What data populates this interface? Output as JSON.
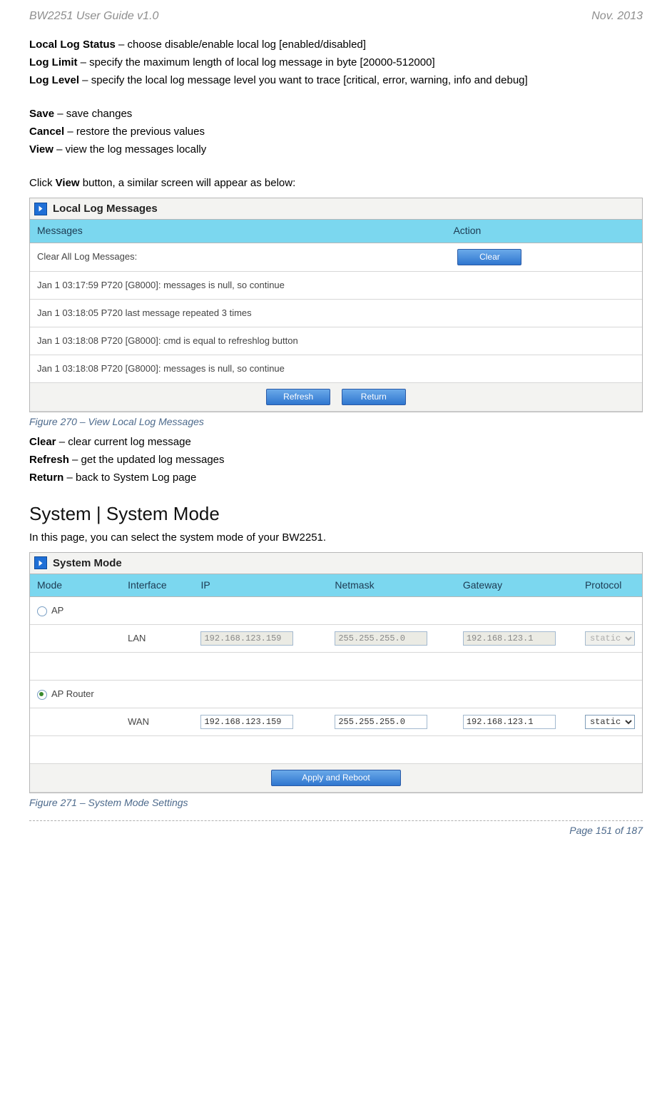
{
  "header": {
    "left": "BW2251 User Guide v1.0",
    "right": "Nov.  2013"
  },
  "defs": {
    "localLogStatus": {
      "term": "Local Log Status",
      "desc": " – choose disable/enable local log [enabled/disabled]"
    },
    "logLimit": {
      "term": "Log Limit",
      "desc": " – specify the maximum length of local log message in byte [20000-512000]"
    },
    "logLevel": {
      "term": "Log Level",
      "desc": " – specify the local log message level you want to trace [critical, error, warning, info and debug]"
    },
    "save": {
      "term": "Save",
      "desc": " – save changes"
    },
    "cancel": {
      "term": "Cancel",
      "desc": " – restore the previous values"
    },
    "view": {
      "term": "View",
      "desc": " – view the log messages locally"
    },
    "clickView_pre": "Click ",
    "clickView_bold": "View",
    "clickView_post": " button, a similar screen will appear as below:",
    "clear": {
      "term": "Clear",
      "desc": " – clear current log message"
    },
    "refresh": {
      "term": "Refresh",
      "desc": " – get the updated log messages"
    },
    "return": {
      "term": "Return",
      "desc": " – back to System Log page"
    }
  },
  "logBox": {
    "title": "Local Log Messages",
    "cols": {
      "messages": "Messages",
      "action": "Action"
    },
    "clearRowLabel": "Clear All Log Messages:",
    "clearBtn": "Clear",
    "rows": [
      "Jan 1 03:17:59 P720 [G8000]: messages is null, so continue",
      "Jan 1 03:18:05 P720 last message repeated 3 times",
      "Jan 1 03:18:08 P720 [G8000]: cmd is equal to refreshlog button",
      "Jan 1 03:18:08 P720 [G8000]: messages is null, so continue"
    ],
    "refreshBtn": "Refresh",
    "returnBtn": "Return"
  },
  "fig270": "Figure 270 – View Local Log Messages",
  "sectionTitle": "System | System Mode",
  "sectionIntro": "In this page, you can select the system mode of your BW2251.",
  "modeBox": {
    "title": "System Mode",
    "cols": {
      "mode": "Mode",
      "iface": "Interface",
      "ip": "IP",
      "netmask": "Netmask",
      "gateway": "Gateway",
      "proto": "Protocol"
    },
    "apLabel": "AP",
    "apRouterLabel": "AP Router",
    "lanLabel": "LAN",
    "wanLabel": "WAN",
    "lan": {
      "ip": "192.168.123.159",
      "mask": "255.255.255.0",
      "gw": "192.168.123.1",
      "proto": "static"
    },
    "wan": {
      "ip": "192.168.123.159",
      "mask": "255.255.255.0",
      "gw": "192.168.123.1",
      "proto": "static"
    },
    "applyBtn": "Apply and Reboot"
  },
  "fig271": "Figure 271 – System Mode Settings",
  "footer": "Page 151 of 187"
}
